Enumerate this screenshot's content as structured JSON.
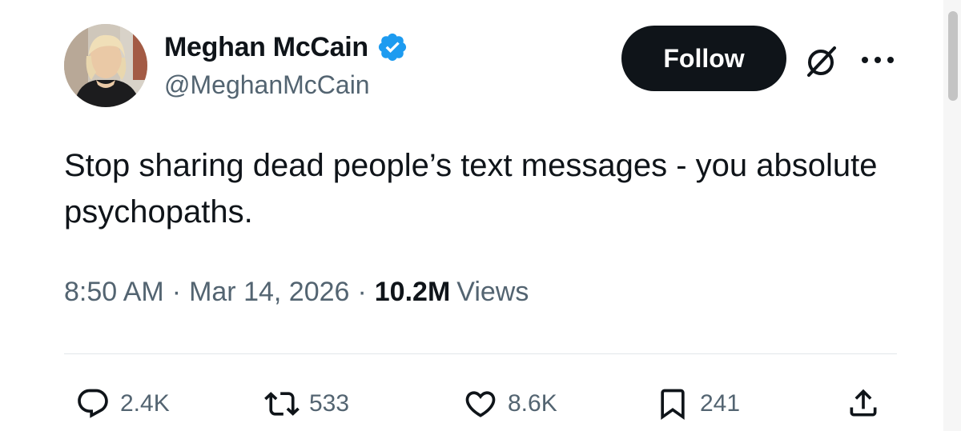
{
  "author": {
    "display_name": "Meghan McCain",
    "handle": "@MeghanMcCain",
    "verified": true
  },
  "header": {
    "follow_label": "Follow",
    "grok_icon": "grok-icon",
    "more_icon": "more-icon"
  },
  "tweet": {
    "text": "Stop sharing dead people’s text messages - you absolute psychopaths."
  },
  "meta": {
    "time": "8:50 AM",
    "separator": "·",
    "date": "Mar 14, 2026",
    "views_count": "10.2M",
    "views_label": "Views"
  },
  "actions": {
    "replies": "2.4K",
    "reposts": "533",
    "likes": "8.6K",
    "bookmarks": "241"
  },
  "colors": {
    "text_primary": "#0f1419",
    "text_secondary": "#536471",
    "verified_blue": "#1d9bf0",
    "follow_bg": "#0f1419"
  }
}
